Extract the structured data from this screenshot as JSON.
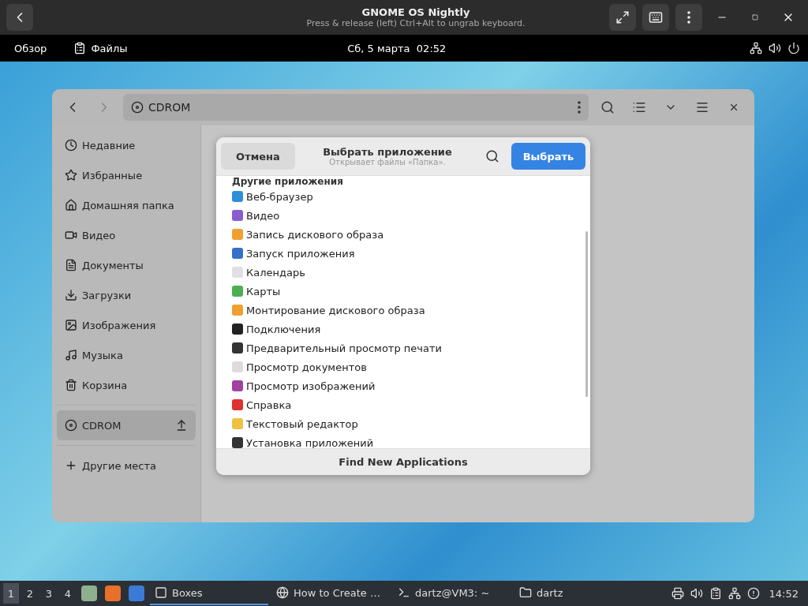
{
  "vm_bar": {
    "title": "GNOME OS Nightly",
    "subtitle": "Press & release (left) Ctrl+Alt to ungrab keyboard."
  },
  "top_bar": {
    "overview": "Обзор",
    "app": "Файлы",
    "clock": "Сб, 5 марта  02:52"
  },
  "files": {
    "path": "CDROM",
    "sidebar": [
      {
        "label": "Недавние",
        "selected": false
      },
      {
        "label": "Избранные",
        "selected": false
      },
      {
        "label": "Домашняя папка",
        "selected": false
      },
      {
        "label": "Видео",
        "selected": false
      },
      {
        "label": "Документы",
        "selected": false
      },
      {
        "label": "Загрузки",
        "selected": false
      },
      {
        "label": "Изображения",
        "selected": false
      },
      {
        "label": "Музыка",
        "selected": false
      },
      {
        "label": "Корзина",
        "selected": false
      }
    ],
    "devices": [
      {
        "label": "CDROM",
        "selected": true
      }
    ],
    "other": "Другие места"
  },
  "dialog": {
    "cancel": "Отмена",
    "title": "Выбрать приложение",
    "subtitle": "Открывает файлы «Папка».",
    "select": "Выбрать",
    "section": "Другие приложения",
    "apps": [
      {
        "label": "Веб-браузер",
        "selected": false
      },
      {
        "label": "Видео",
        "selected": false
      },
      {
        "label": "Запись дискового образа",
        "selected": false
      },
      {
        "label": "Запуск приложения",
        "selected": false
      },
      {
        "label": "Календарь",
        "selected": false
      },
      {
        "label": "Карты",
        "selected": false
      },
      {
        "label": "Монтирование дискового образа",
        "selected": false
      },
      {
        "label": "Подключения",
        "selected": false
      },
      {
        "label": "Предварительный просмотр печати",
        "selected": false
      },
      {
        "label": "Просмотр документов",
        "selected": false
      },
      {
        "label": "Просмотр изображений",
        "selected": false
      },
      {
        "label": "Справка",
        "selected": false
      },
      {
        "label": "Текстовый редактор",
        "selected": false
      },
      {
        "label": "Установка приложений",
        "selected": false
      }
    ],
    "footer": "Find New Applications"
  },
  "taskbar": {
    "workspaces": [
      {
        "label": "1",
        "selected": true
      },
      {
        "label": "2",
        "selected": false
      },
      {
        "label": "3",
        "selected": false
      },
      {
        "label": "4",
        "selected": false
      }
    ],
    "tasks": [
      {
        "label": "Boxes",
        "kind": "boxes",
        "selected": true
      },
      {
        "label": "How to Create …",
        "kind": "browser",
        "selected": false
      },
      {
        "label": "dartz@VM3: ~",
        "kind": "terminal",
        "selected": false
      },
      {
        "label": "dartz",
        "kind": "folder",
        "selected": false
      }
    ],
    "clock": "14:52"
  }
}
